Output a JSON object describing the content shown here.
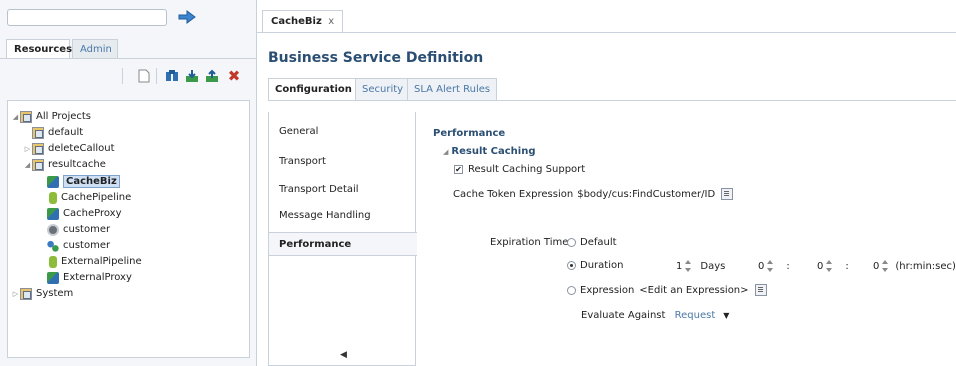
{
  "left_panel": {
    "search": {
      "value": "",
      "placeholder": ""
    },
    "tabs": [
      {
        "label": "Resources"
      },
      {
        "label": "Admin"
      }
    ],
    "toolbar_icons": [
      "new-document-icon",
      "find-icon",
      "import-icon",
      "export-icon",
      "delete-icon"
    ],
    "tree": [
      {
        "label": "All Projects",
        "icon": "folder-icon"
      },
      {
        "label": "default",
        "icon": "folder-icon"
      },
      {
        "label": "deleteCallout",
        "icon": "folder-icon"
      },
      {
        "label": "resultcache",
        "icon": "folder-icon"
      },
      {
        "label": "CacheBiz",
        "icon": "business-service-icon"
      },
      {
        "label": "CachePipeline",
        "icon": "pipeline-icon"
      },
      {
        "label": "CacheProxy",
        "icon": "proxy-service-icon"
      },
      {
        "label": "customer",
        "icon": "gear-icon"
      },
      {
        "label": "customer",
        "icon": "people-icon"
      },
      {
        "label": "ExternalPipeline",
        "icon": "pipeline-icon"
      },
      {
        "label": "ExternalProxy",
        "icon": "proxy-service-icon"
      },
      {
        "label": "System",
        "icon": "folder-icon"
      }
    ]
  },
  "editor": {
    "doc_tab": {
      "label": "CacheBiz",
      "close": "x"
    },
    "title": "Business Service Definition",
    "subtabs": [
      {
        "label": "Configuration"
      },
      {
        "label": "Security"
      },
      {
        "label": "SLA Alert Rules"
      }
    ],
    "nav": [
      {
        "label": "General"
      },
      {
        "label": "Transport"
      },
      {
        "label": "Transport Detail"
      },
      {
        "label": "Message Handling"
      },
      {
        "label": "Performance"
      }
    ],
    "performance": {
      "section_title": "Performance",
      "group_title": "Result Caching",
      "checkbox_label": "Result Caching Support",
      "checkbox_checked": true,
      "token_label": "Cache Token Expression",
      "token_value": "$body/cus:FindCustomer/ID",
      "expiration_label": "Expiration Time",
      "radio_default": "Default",
      "radio_duration": "Duration",
      "radio_expression": "Expression",
      "selected_radio": "Duration",
      "duration_value": "1",
      "days_label": "Days",
      "hours_value": "0",
      "minutes_value": "0",
      "seconds_value": "0",
      "separator": ":",
      "time_format": "(hr:min:sec)",
      "expression_placeholder": "<Edit an Expression>",
      "evaluate_label": "Evaluate Against",
      "evaluate_value": "Request"
    }
  },
  "colors": {
    "title": "#2b4f73",
    "link": "#4a78a8",
    "selection": "#cfe0f4",
    "border": "#c9d1da"
  }
}
